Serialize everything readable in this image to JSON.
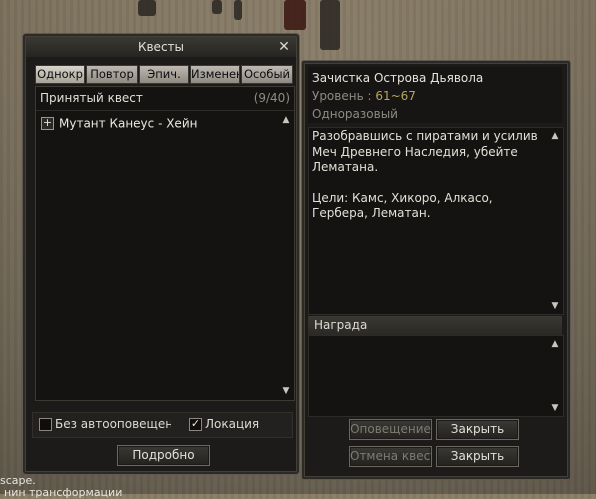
{
  "scene": {
    "bottom_text_1": "scape.",
    "bottom_text_2": "нин трансформации"
  },
  "left_window": {
    "title": "Квесты",
    "tabs": [
      "Однокр",
      "Повтор",
      "Эпич.",
      "Изменен",
      "Особый"
    ],
    "active_tab_index": 0,
    "list_header": "Принятый квест",
    "list_count": "(9/40)",
    "quests": [
      {
        "name": "Мутант Канеус - Хейн"
      }
    ],
    "options": {
      "no_autonotify_label": "Без автооповещен",
      "no_autonotify_checked": false,
      "location_label": "Локация",
      "location_checked": true
    },
    "details_button": "Подробно"
  },
  "right_window": {
    "quest_title": "Зачистка Острова Дьявола",
    "level_label": "Уровень :",
    "level_value": "61~67",
    "quest_type": "Одноразовый",
    "description": "Разобравшись с пиратами и усилив Меч Древнего Наследия, убейте Лематана.",
    "goals": "Цели: Камс, Хикоро, Алкасо, Гербера, Лематан.",
    "reward_header": "Награда",
    "buttons": {
      "notify": "Оповещение",
      "close_1": "Закрыть",
      "cancel_quest": "Отмена квеста",
      "close_2": "Закрыть"
    }
  }
}
